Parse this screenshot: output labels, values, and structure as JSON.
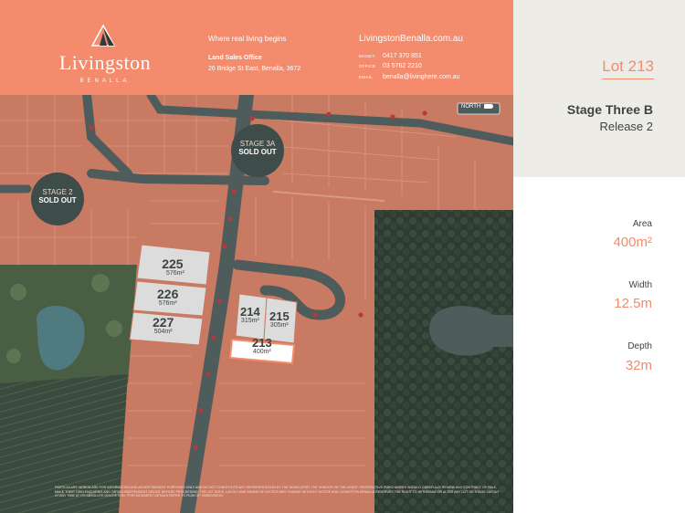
{
  "brand": {
    "name": "Livingston",
    "subtitle": "BENALLA",
    "tagline": "Where real living begins",
    "office_label": "Land Sales Office",
    "office_address": "26 Bridge St East, Benalla, 3672",
    "website": "LivingstonBenalla.com.au",
    "contacts": [
      {
        "label": "MANDY",
        "value": "0417 370 851"
      },
      {
        "label": "OFFICE",
        "value": "03 5762 2210"
      },
      {
        "label": "EMAIL",
        "value": "benalla@livinghere.com.au"
      }
    ]
  },
  "lot": {
    "title": "Lot 213",
    "stage": "Stage Three B",
    "release": "Release 2",
    "area_label": "Area",
    "area_value": "400m²",
    "width_label": "Width",
    "width_value": "12.5m",
    "depth_label": "Depth",
    "depth_value": "32m"
  },
  "map": {
    "north_label": "NORTH",
    "stage_badges": [
      {
        "line1": "STAGE 3A",
        "line2": "SOLD OUT"
      },
      {
        "line1": "STAGE 2",
        "line2": "SOLD OUT"
      }
    ],
    "lots": [
      {
        "number": "225",
        "area": "576m²"
      },
      {
        "number": "226",
        "area": "576m²"
      },
      {
        "number": "227",
        "area": "504m²"
      },
      {
        "number": "214",
        "area": "315m²"
      },
      {
        "number": "215",
        "area": "305m²"
      },
      {
        "number": "213",
        "area": "400m²"
      }
    ],
    "colors": {
      "lot_land": "#c87a63",
      "available_lot": "#dcdcdc",
      "highlight": "#f38b6c",
      "park": "#3a4a3c",
      "road": "#4f5c5c"
    }
  },
  "disclaimer": "PARTICULARS HEREIN ARE FOR INFORMATION AND ADVERTISEMENT PURPOSES ONLY AND DO NOT CONSTITUTE ANY REPRESENTATION BY THE DEVELOPER, THE VENDOR OR THE AGENT. PROSPECTIVE PURCHASERS SHOULD CAREFULLY REVIEW ANY CONTRACT OF SALE, MAKE THEIR OWN ENQUIRIES AND OBTAIN INDEPENDENT ADVICE BEFORE PROCEEDING. THE LOT SIZES, LAYOUT AND MEANS OF ACCESS MAY CHANGE WITHOUT NOTICE AND LIVINGSTON BENALLA RESERVES THE RIGHT TO WITHDRAW OR ALTER ANY LOT OR STAGE LAYOUT AT ANY TIME AT ITS ABSOLUTE DISCRETION. *FOR EASEMENT DETAILS REFER TO PLAN OF SUBDIVISION."
}
